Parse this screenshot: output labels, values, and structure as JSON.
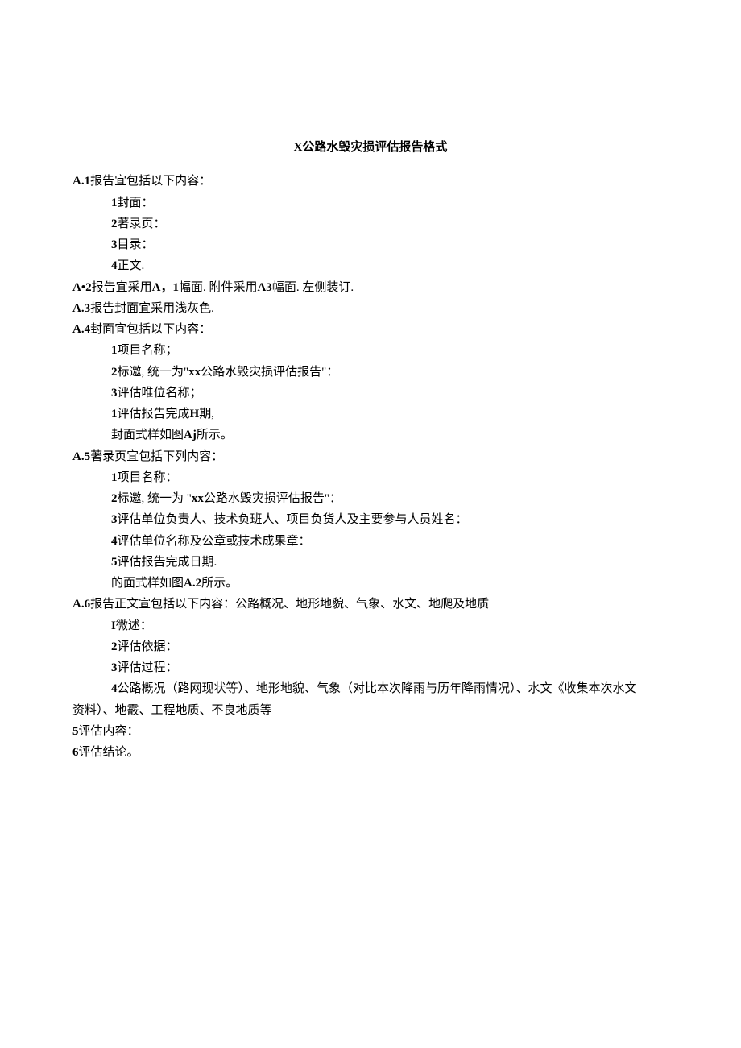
{
  "title": "X公路水毁灾损评估报告格式",
  "a1": {
    "header_bold": "A.1",
    "header_text": "报告宜包括以下内容：",
    "items": [
      {
        "bold": "1",
        "text": "封面："
      },
      {
        "bold": "2",
        "text": "著录页："
      },
      {
        "bold": "3",
        "text": "目录："
      },
      {
        "bold": "4",
        "text": "正文."
      }
    ]
  },
  "a2": {
    "bold1": "A•2",
    "text1": "报告宜采用",
    "bold2": "A，1",
    "text2": "幅面. 附件采用",
    "bold3": "A3",
    "text3": "幅面. 左侧装订."
  },
  "a3": {
    "bold": "A.3",
    "text": "报告封面宜采用浅灰色."
  },
  "a4": {
    "header_bold": "A.4",
    "header_text": "封面宜包括以下内容：",
    "items": [
      {
        "bold": "1",
        "text": "项目名称；"
      },
      {
        "bold": "2",
        "text1": "标邀, 统一为\"",
        "bold_inner": "xx",
        "text2": "公路水毁灾损评估报告\"："
      },
      {
        "bold": "3",
        "text": "评估唯位名称；"
      },
      {
        "bold": "1",
        "text1": "评估报告完成",
        "bold_inner": "H",
        "text2": "期,"
      },
      {
        "text1": "封面式样如图",
        "bold_inner": "Aj",
        "text2": "所示。"
      }
    ]
  },
  "a5": {
    "header_bold": "A.5",
    "header_text": "著录页宜包括下列内容：",
    "items": [
      {
        "bold": "1",
        "text": "项目名称："
      },
      {
        "bold": "2",
        "text1": "标邀, 统一为 \"",
        "bold_inner": "xx",
        "text2": "公路水毁灾损评估报告\"："
      },
      {
        "bold": "3",
        "text": "评估单位负责人、技术负班人、项目负货人及主要参与人员姓名："
      },
      {
        "bold": "4",
        "text": "评估单位名称及公章或技术成果章："
      },
      {
        "bold": "5",
        "text": "评估报告完成日期."
      },
      {
        "text1": "的面式样如图",
        "bold_inner": "A.2",
        "text2": "所示。"
      }
    ]
  },
  "a6": {
    "header_bold": "A.6",
    "header_text": "报告正文宣包括以下内容：公路概况、地形地貌、气象、水文、地爬及地质",
    "items": [
      {
        "bold": "I",
        "text": "微述："
      },
      {
        "bold": "2",
        "text": "评估依据："
      },
      {
        "bold": "3",
        "text": "评估过程："
      },
      {
        "bold": "4",
        "text": "公路概况（路网现状等）、地形地貌、气象（对比本次降雨与历年降雨情况）、水文《收集本次水文"
      }
    ],
    "line_wrap": "资料）、地霰、工程地质、不良地质等",
    "item5_bold": "5",
    "item5_text": "评估内容：",
    "item6_bold": "6",
    "item6_text": "评估结论。"
  }
}
